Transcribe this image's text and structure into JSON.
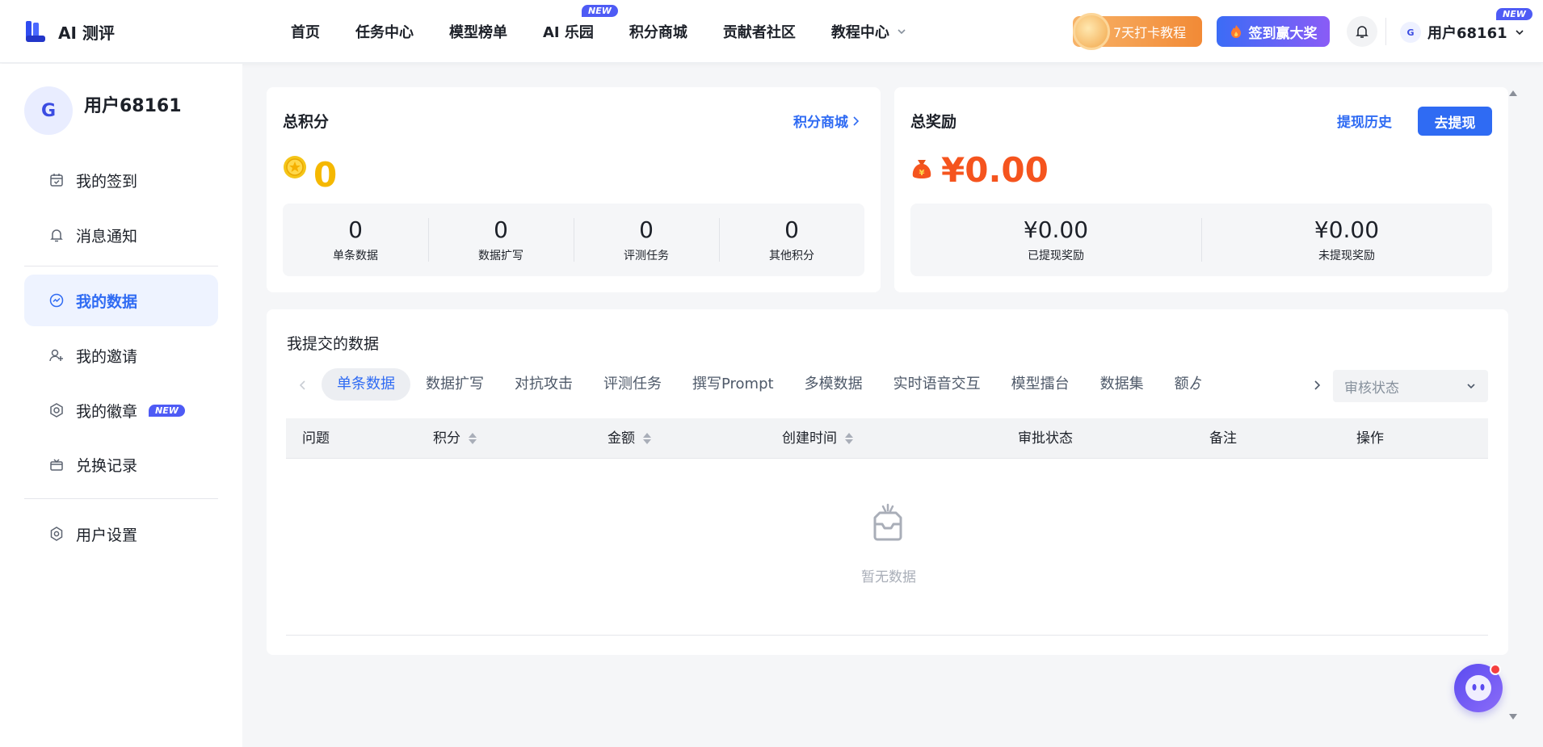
{
  "header": {
    "logo_text": "AI 测评",
    "nav": [
      {
        "label": "首页"
      },
      {
        "label": "任务中心"
      },
      {
        "label": "模型榜单"
      },
      {
        "label": "AI 乐园",
        "badge": "NEW"
      },
      {
        "label": "积分商城"
      },
      {
        "label": "贡献者社区"
      },
      {
        "label": "教程中心"
      }
    ],
    "tutorial_button": "7天打卡教程",
    "sign_button": "签到赢大奖",
    "user_name": "用户68161",
    "user_badge": "NEW",
    "avatar_text": "G"
  },
  "sidebar": {
    "user_name": "用户68161",
    "avatar_text": "G",
    "items": [
      {
        "label": "我的签到"
      },
      {
        "label": "消息通知"
      },
      {
        "label": "我的数据"
      },
      {
        "label": "我的邀请"
      },
      {
        "label": "我的徽章",
        "badge": "NEW"
      },
      {
        "label": "兑换记录"
      },
      {
        "label": "用户设置"
      }
    ]
  },
  "points_card": {
    "title": "总积分",
    "link": "积分商城",
    "total": "0",
    "stats": [
      {
        "value": "0",
        "label": "单条数据"
      },
      {
        "value": "0",
        "label": "数据扩写"
      },
      {
        "value": "0",
        "label": "评测任务"
      },
      {
        "value": "0",
        "label": "其他积分"
      }
    ]
  },
  "reward_card": {
    "title": "总奖励",
    "history_link": "提现历史",
    "withdraw_button": "去提现",
    "total": "¥0.00",
    "stats": [
      {
        "value": "¥0.00",
        "label": "已提现奖励"
      },
      {
        "value": "¥0.00",
        "label": "未提现奖励"
      }
    ]
  },
  "submitted": {
    "title": "我提交的数据",
    "tabs": [
      "单条数据",
      "数据扩写",
      "对抗攻击",
      "评测任务",
      "撰写Prompt",
      "多模数据",
      "实时语音交互",
      "模型擂台",
      "数据集",
      "额ゟ"
    ],
    "active_tab": 0,
    "status_placeholder": "审核状态",
    "columns": [
      "问题",
      "积分",
      "金额",
      "创建时间",
      "审批状态",
      "备注",
      "操作"
    ],
    "empty_text": "暂无数据"
  },
  "colors": {
    "primary": "#2f6bf3",
    "points": "#f5b800",
    "money": "#f5541e",
    "badge": "#4e5bf5"
  }
}
